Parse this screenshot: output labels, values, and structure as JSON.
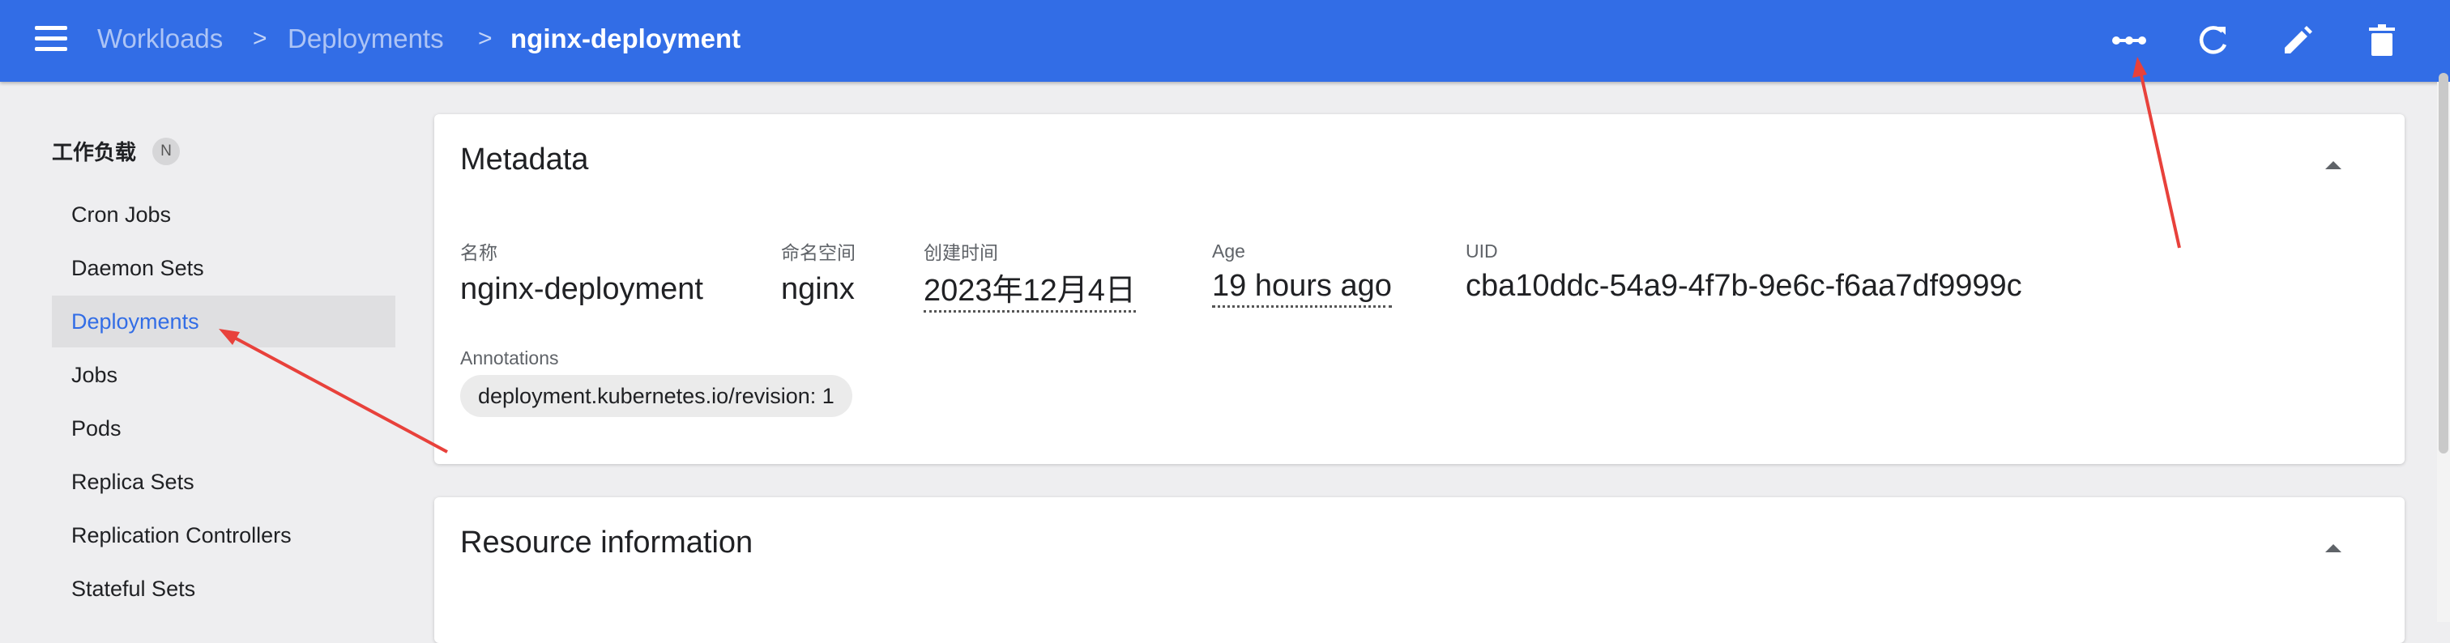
{
  "topbar": {
    "breadcrumbs": [
      {
        "label": "Workloads"
      },
      {
        "label": "Deployments"
      },
      {
        "label": "nginx-deployment"
      }
    ],
    "separator": ">",
    "icons": [
      "menu-icon",
      "scale-icon",
      "refresh-icon",
      "edit-icon",
      "delete-icon"
    ]
  },
  "sidebar": {
    "heading": "工作负载",
    "badge": "N",
    "items": [
      {
        "label": "Cron Jobs"
      },
      {
        "label": "Daemon Sets"
      },
      {
        "label": "Deployments",
        "active": true
      },
      {
        "label": "Jobs"
      },
      {
        "label": "Pods"
      },
      {
        "label": "Replica Sets"
      },
      {
        "label": "Replication Controllers"
      },
      {
        "label": "Stateful Sets"
      }
    ]
  },
  "metadata": {
    "title": "Metadata",
    "fields": {
      "name": {
        "label": "名称",
        "value": "nginx-deployment"
      },
      "namespace": {
        "label": "命名空间",
        "value": "nginx"
      },
      "created": {
        "label": "创建时间",
        "value": "2023年12月4日"
      },
      "age": {
        "label": "Age",
        "value": "19 hours ago"
      },
      "uid": {
        "label": "UID",
        "value": "cba10ddc-54a9-4f7b-9e6c-f6aa7df9999c"
      }
    },
    "annotations_label": "Annotations",
    "annotations": [
      "deployment.kubernetes.io/revision: 1"
    ]
  },
  "resource": {
    "title": "Resource information"
  },
  "colors": {
    "topbar": "#326de6",
    "accent": "#326de6",
    "annotation_arrow": "#e8413b",
    "background": "#eeeef0"
  }
}
